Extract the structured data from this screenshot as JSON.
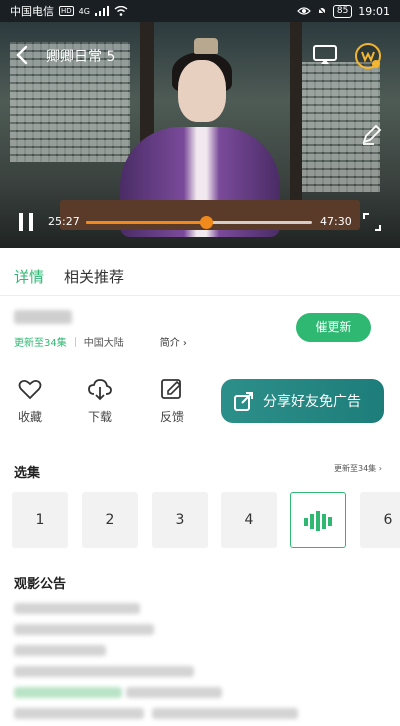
{
  "status_bar": {
    "carrier": "中国电信",
    "hd": "HD",
    "signal": "4G",
    "battery": "85",
    "time": "19:01"
  },
  "player": {
    "title": "卿卿日常 5",
    "current_time": "25:27",
    "total_time": "47:30",
    "progress": 0.53,
    "accent_color": "#f08a1c"
  },
  "tabs": [
    {
      "label": "详情",
      "active": true
    },
    {
      "label": "相关推荐",
      "active": false
    }
  ],
  "info": {
    "update_status": "更新至34集",
    "region": "中国大陆",
    "intro_label": "简介",
    "follow_label": "催更新"
  },
  "actions": [
    {
      "icon": "heart-icon",
      "label": "收藏"
    },
    {
      "icon": "download-icon",
      "label": "下载"
    },
    {
      "icon": "feedback-icon",
      "label": "反馈"
    }
  ],
  "share": {
    "label": "分享好友免广告",
    "icon": "share-icon"
  },
  "episodes": {
    "title": "选集",
    "more_label": "更新至34集",
    "items": [
      "1",
      "2",
      "3",
      "4",
      "",
      "6"
    ],
    "playing_index": 4
  },
  "notice": {
    "title": "观影公告"
  },
  "colors": {
    "brand_green": "#2eb872",
    "share_teal": "#1d7d7a"
  }
}
